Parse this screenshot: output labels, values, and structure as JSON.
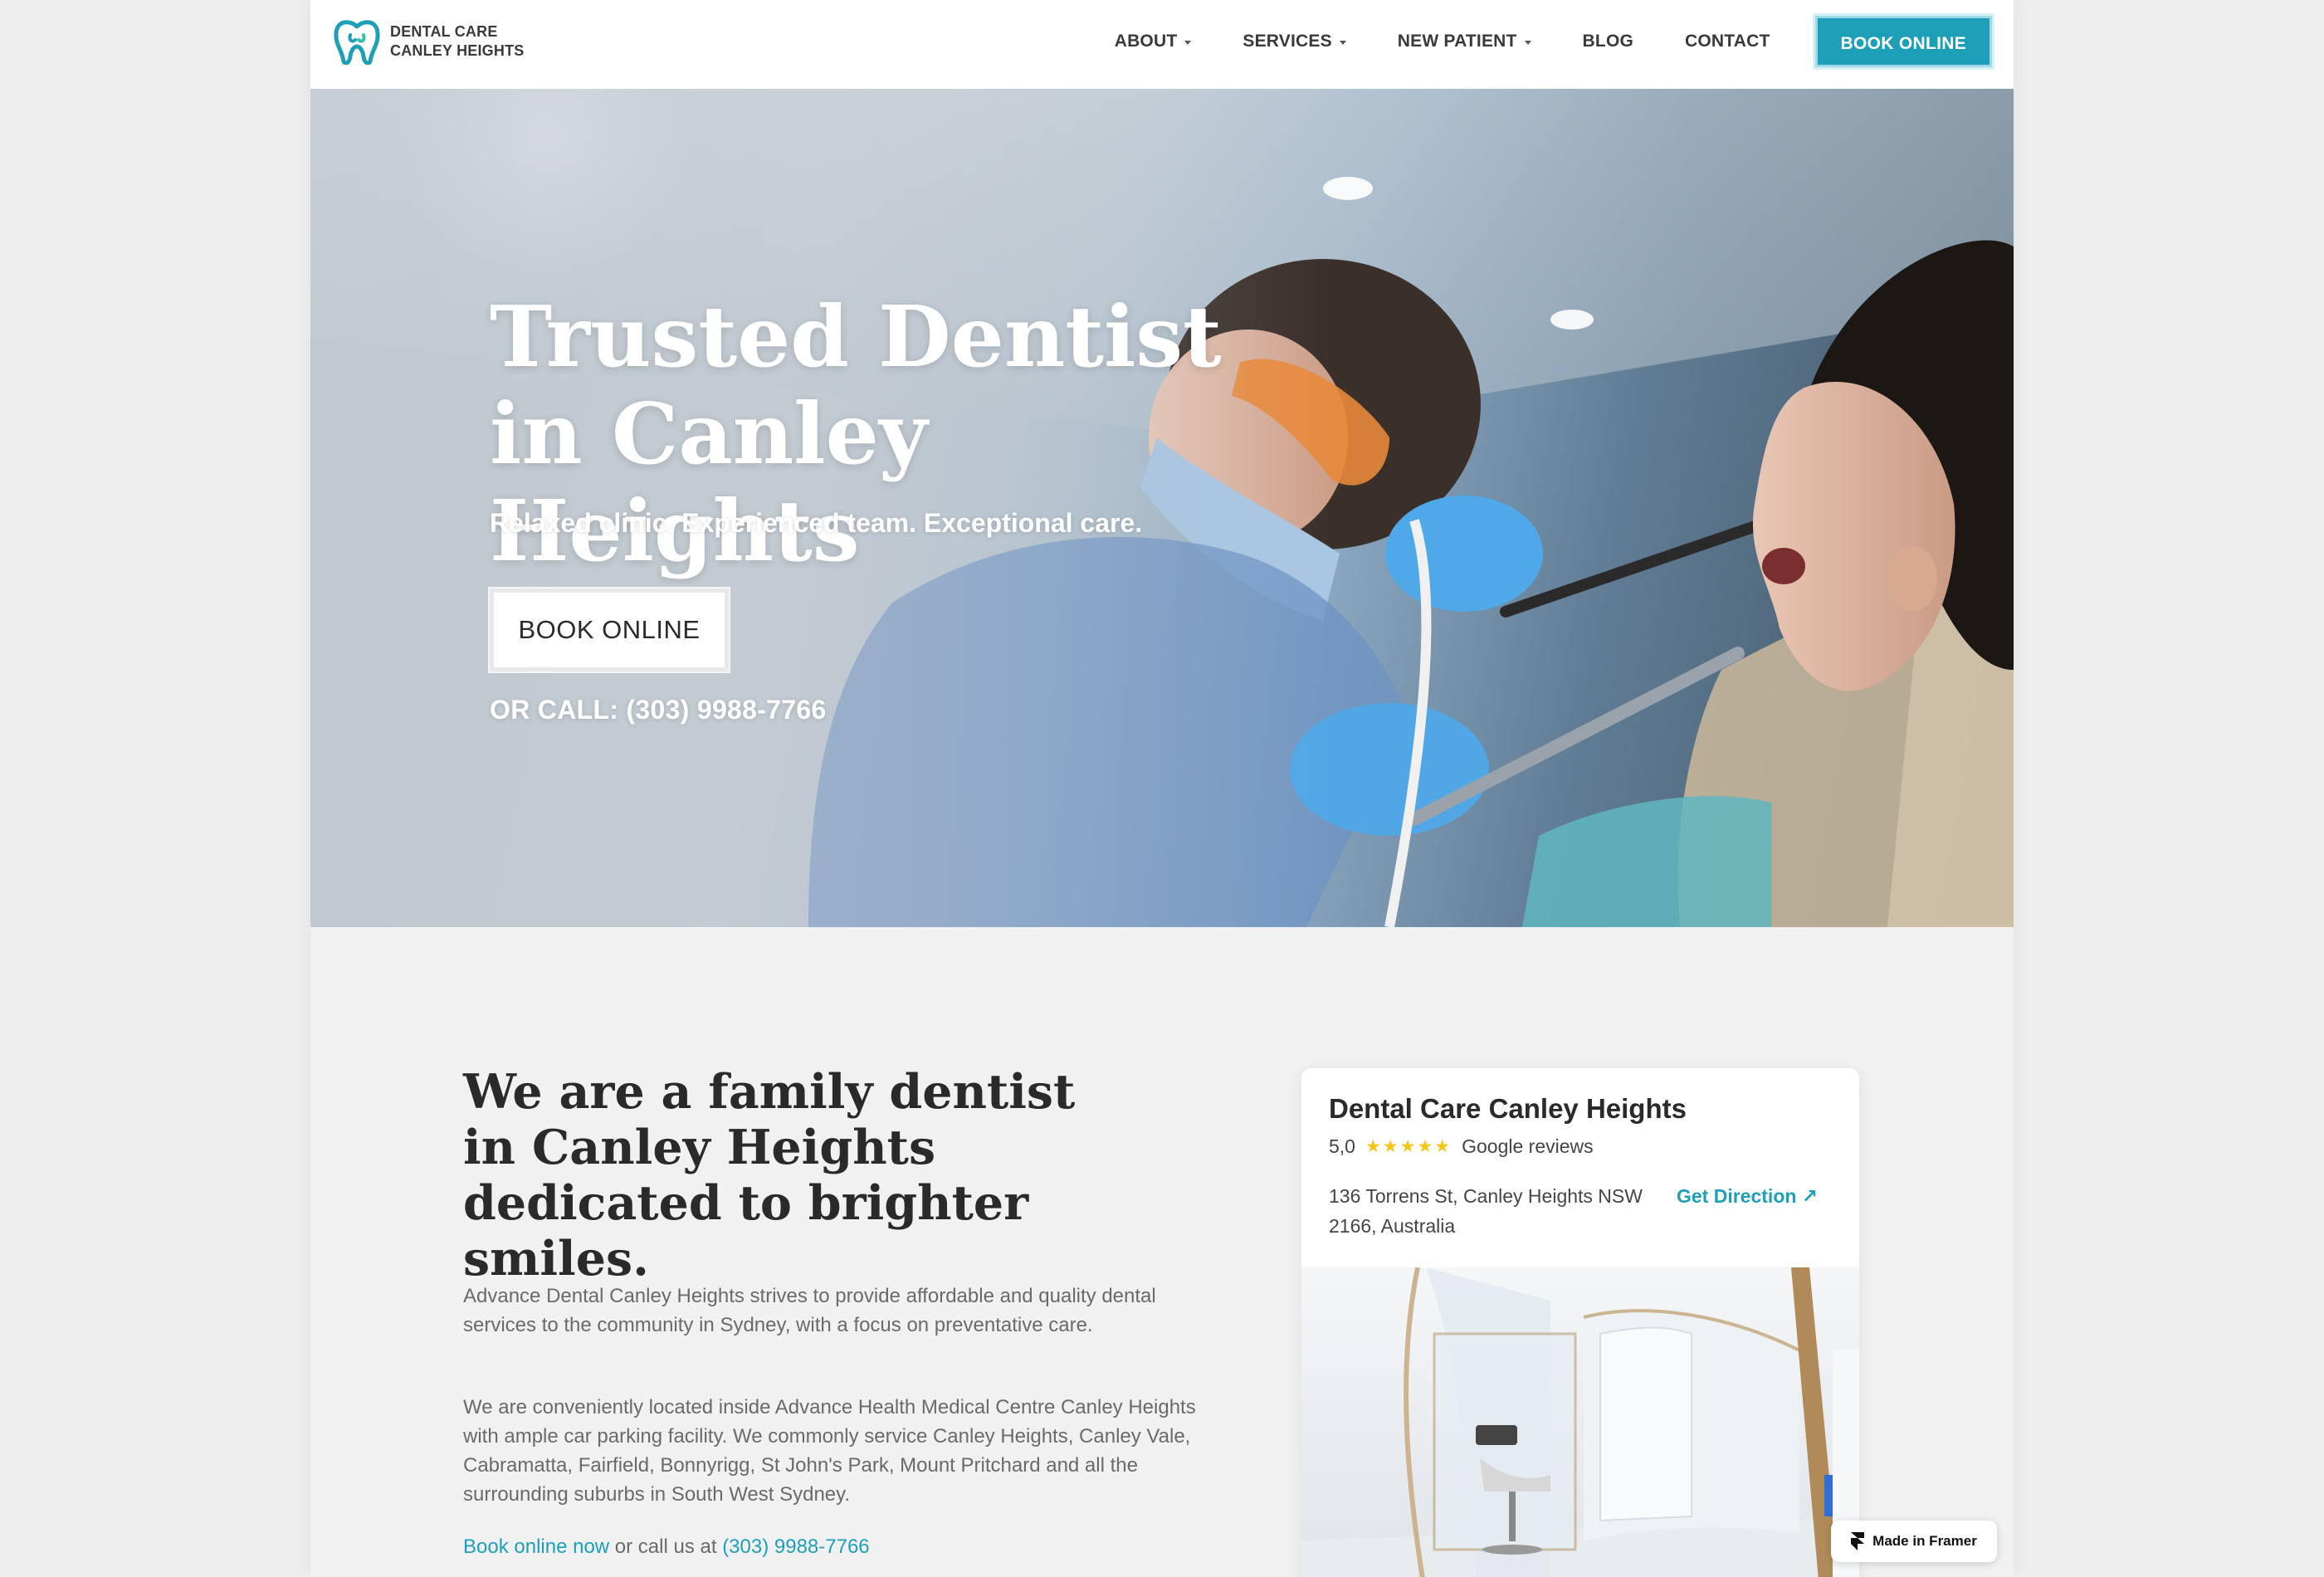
{
  "brand": {
    "line1": "DENTAL CARE",
    "line2": "CANLEY HEIGHTS",
    "accent": "#1e9fb8"
  },
  "nav": {
    "items": [
      {
        "label": "ABOUT",
        "dropdown": true
      },
      {
        "label": "SERVICES",
        "dropdown": true
      },
      {
        "label": "NEW PATIENT",
        "dropdown": true
      },
      {
        "label": "BLOG",
        "dropdown": false
      },
      {
        "label": "CONTACT",
        "dropdown": false
      }
    ],
    "book_label": "BOOK ONLINE"
  },
  "hero": {
    "title": "Trusted Dentist in Canley Heights",
    "subtitle": "Relaxed clinic. Experienced team. Exceptional care.",
    "book_label": "BOOK ONLINE",
    "call_text": "OR CALL: (303) 9988-7766"
  },
  "about": {
    "title": "We are a family dentist in Canley Heights dedicated to brighter smiles.",
    "p1": "Advance Dental Canley Heights strives to provide affordable and quality dental services to the community in Sydney, with a focus on preventative care.",
    "p2": "We are conveniently located inside Advance Health Medical Centre Canley Heights with ample car parking facility. We commonly service Canley Heights, Canley Vale, Cabramatta, Fairfield, Bonnyrigg, St John's Park, Mount Pritchard and all the surrounding suburbs in South West Sydney.",
    "cta_link": "Book online now",
    "cta_middle": " or call us at ",
    "cta_phone": "(303) 9988-7766"
  },
  "card": {
    "name": "Dental Care Canley Heights",
    "rating": "5,0",
    "stars": "★★★★★",
    "reviews_label": "Google reviews",
    "address": "136 Torrens St, Canley Heights NSW 2166, Australia",
    "direction_label": "Get Direction ↗"
  },
  "framer_badge": "Made in Framer",
  "icons": [
    "tooth-logo-icon",
    "caret-down-icon",
    "star-icon",
    "arrow-up-right-icon",
    "framer-icon"
  ]
}
